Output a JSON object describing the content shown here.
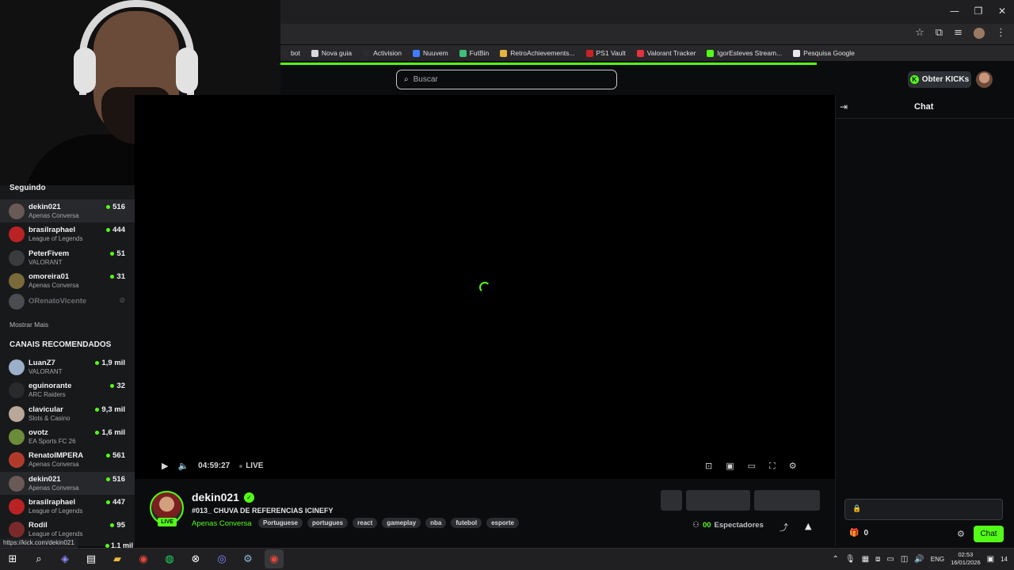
{
  "bookmarks": [
    {
      "label": "bot",
      "color": "#2b2b2e"
    },
    {
      "label": "Nova guia",
      "color": "#d8d8d8"
    },
    {
      "label": "Activision",
      "color": "#2b2b2e"
    },
    {
      "label": "Nuuvem",
      "color": "#3f7cff"
    },
    {
      "label": "FutBin",
      "color": "#3ec07a"
    },
    {
      "label": "RetroAchievements...",
      "color": "#e5b53c"
    },
    {
      "label": "PS1 Vault",
      "color": "#c82222"
    },
    {
      "label": "Valorant Tracker",
      "color": "#e2323c"
    },
    {
      "label": "IgorEsteves Stream...",
      "color": "#53fc18"
    },
    {
      "label": "Pesquisa Google",
      "color": "#e8e8e8"
    }
  ],
  "search": {
    "placeholder": "Buscar"
  },
  "header": {
    "kicks_label": "Obter KICKs",
    "kicks_icon": "K"
  },
  "sidebar": {
    "following_title": "Seguindo",
    "following": [
      {
        "name": "dekin021",
        "category": "Apenas Conversa",
        "viewers": "516",
        "avatar": "#6a5a55",
        "active": true
      },
      {
        "name": "brasilraphael",
        "category": "League of Legends",
        "viewers": "444",
        "avatar": "#b92323"
      },
      {
        "name": "PeterFivem",
        "category": "VALORANT",
        "viewers": "51",
        "avatar": "#3b3b3b"
      },
      {
        "name": "omoreira01",
        "category": "Apenas Conversa",
        "viewers": "31",
        "avatar": "#7a6a3a"
      }
    ],
    "offline": {
      "name": "ORenatoVicente",
      "avatar": "#4a4c50"
    },
    "show_more": "Mostrar Mais",
    "recommended_title": "CANAIS RECOMENDADOS",
    "recommended": [
      {
        "name": "LuanZ7",
        "category": "VALORANT",
        "viewers": "1,9 mil",
        "avatar": "#9ab0c8"
      },
      {
        "name": "eguinorante",
        "category": "ARC Raiders",
        "viewers": "32",
        "avatar": "#2a2a2a"
      },
      {
        "name": "clavicular",
        "category": "Slots & Casino",
        "viewers": "9,3 mil",
        "avatar": "#b9a79a"
      },
      {
        "name": "ovotz",
        "category": "EA Sports FC 26",
        "viewers": "1,6 mil",
        "avatar": "#6b8c3a"
      },
      {
        "name": "RenatoIMPERA",
        "category": "Apenas Conversa",
        "viewers": "561",
        "avatar": "#b13b2a"
      },
      {
        "name": "dekin021",
        "category": "Apenas Conversa",
        "viewers": "516",
        "avatar": "#6a5a55",
        "active": true
      },
      {
        "name": "brasilraphael",
        "category": "League of Legends",
        "viewers": "447",
        "avatar": "#b92323"
      },
      {
        "name": "Rodil",
        "category": "League of Legends",
        "viewers": "95",
        "avatar": "#7a2a2a"
      }
    ],
    "partial_viewers": "1,1 mil"
  },
  "player": {
    "time": "04:59:27",
    "live_label": "LIVE"
  },
  "stream": {
    "live_badge": "LIVE",
    "name": "dekin021",
    "title": "#013_ CHUVA DE REFERENCIAS ICINEFY",
    "category": "Apenas Conversa",
    "tags": [
      "Portuguese",
      "portugues",
      "react",
      "gameplay",
      "nba",
      "futebol",
      "esporte"
    ],
    "viewers_count": "00",
    "viewers_label": "Espectadores"
  },
  "chat": {
    "title": "Chat",
    "gift_count": "0",
    "send_label": "Chat"
  },
  "status_url": "https://kick.com/dekin021",
  "tray": {
    "lang": "ENG",
    "time": "02:53",
    "date": "16/01/2026",
    "notif": "14"
  },
  "colors": {
    "accent": "#53fc18",
    "background": "#0b0c0e",
    "sidebar": "#18191b"
  }
}
